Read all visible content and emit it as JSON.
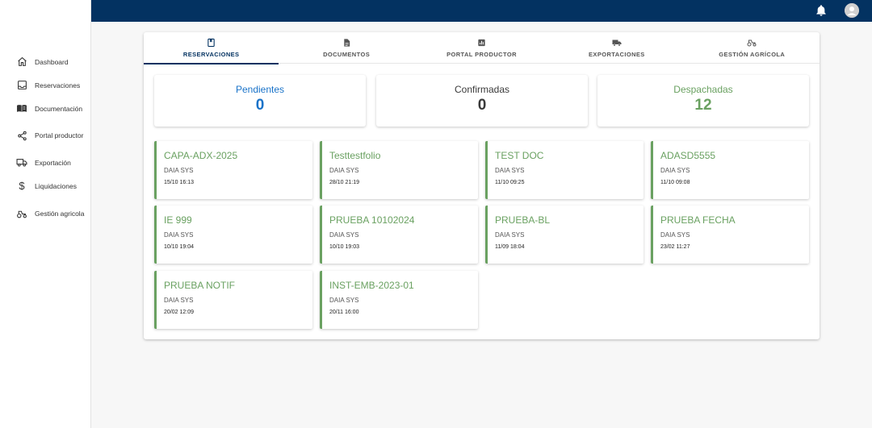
{
  "sidebar": {
    "items": [
      {
        "label": "Dashboard",
        "icon": "home-icon"
      },
      {
        "label": "Reservaciones",
        "icon": "inbox-icon"
      },
      {
        "label": "Documentación",
        "icon": "book-icon"
      },
      {
        "label": "Portal productor",
        "icon": "share-icon"
      },
      {
        "label": "Exportación",
        "icon": "truck-icon"
      },
      {
        "label": "Liquidaciones",
        "icon": "dollar-icon"
      },
      {
        "label": "Gestión agricola",
        "icon": "tractor-icon"
      }
    ]
  },
  "topbar": {
    "notifications_icon": "bell-icon",
    "avatar_icon": "user-avatar-icon"
  },
  "tabs": [
    {
      "label": "RESERVACIONES",
      "icon": "book-icon",
      "active": true
    },
    {
      "label": "DOCUMENTOS",
      "icon": "document-icon",
      "active": false
    },
    {
      "label": "PORTAL PRODUCTOR",
      "icon": "chart-icon",
      "active": false
    },
    {
      "label": "EXPORTACIONES",
      "icon": "truck-icon",
      "active": false
    },
    {
      "label": "GESTIÓN AGRÍCOLA",
      "icon": "tractor-icon",
      "active": false
    }
  ],
  "stats": [
    {
      "label": "Pendientes",
      "value": "0",
      "color": "#1a73c9"
    },
    {
      "label": "Confirmadas",
      "value": "0",
      "color": "#3a3a3a"
    },
    {
      "label": "Despachadas",
      "value": "12",
      "color": "#6aa161"
    }
  ],
  "reservations": [
    {
      "title": "CAPA-ADX-2025",
      "user": "DAIA SYS",
      "date": "15/10 16:13"
    },
    {
      "title": "Testtestfolio",
      "user": "DAIA SYS",
      "date": "28/10 21:19"
    },
    {
      "title": "TEST DOC",
      "user": "DAIA SYS",
      "date": "11/10 09:25"
    },
    {
      "title": "ADASD5555",
      "user": "DAIA SYS",
      "date": "11/10 09:08"
    },
    {
      "title": "IE 999",
      "user": "DAIA SYS",
      "date": "10/10 19:04"
    },
    {
      "title": "PRUEBA 10102024",
      "user": "DAIA SYS",
      "date": "10/10 19:03"
    },
    {
      "title": "PRUEBA-BL",
      "user": "DAIA SYS",
      "date": "11/09 18:04"
    },
    {
      "title": "PRUEBA FECHA",
      "user": "DAIA SYS",
      "date": "23/02 11:27"
    },
    {
      "title": "PRUEBA NOTIF",
      "user": "DAIA SYS",
      "date": "20/02 12:09"
    },
    {
      "title": "INST-EMB-2023-01",
      "user": "DAIA SYS",
      "date": "20/11 16:00"
    }
  ],
  "colors": {
    "primary": "#033261",
    "card_accent": "#6aa161"
  }
}
